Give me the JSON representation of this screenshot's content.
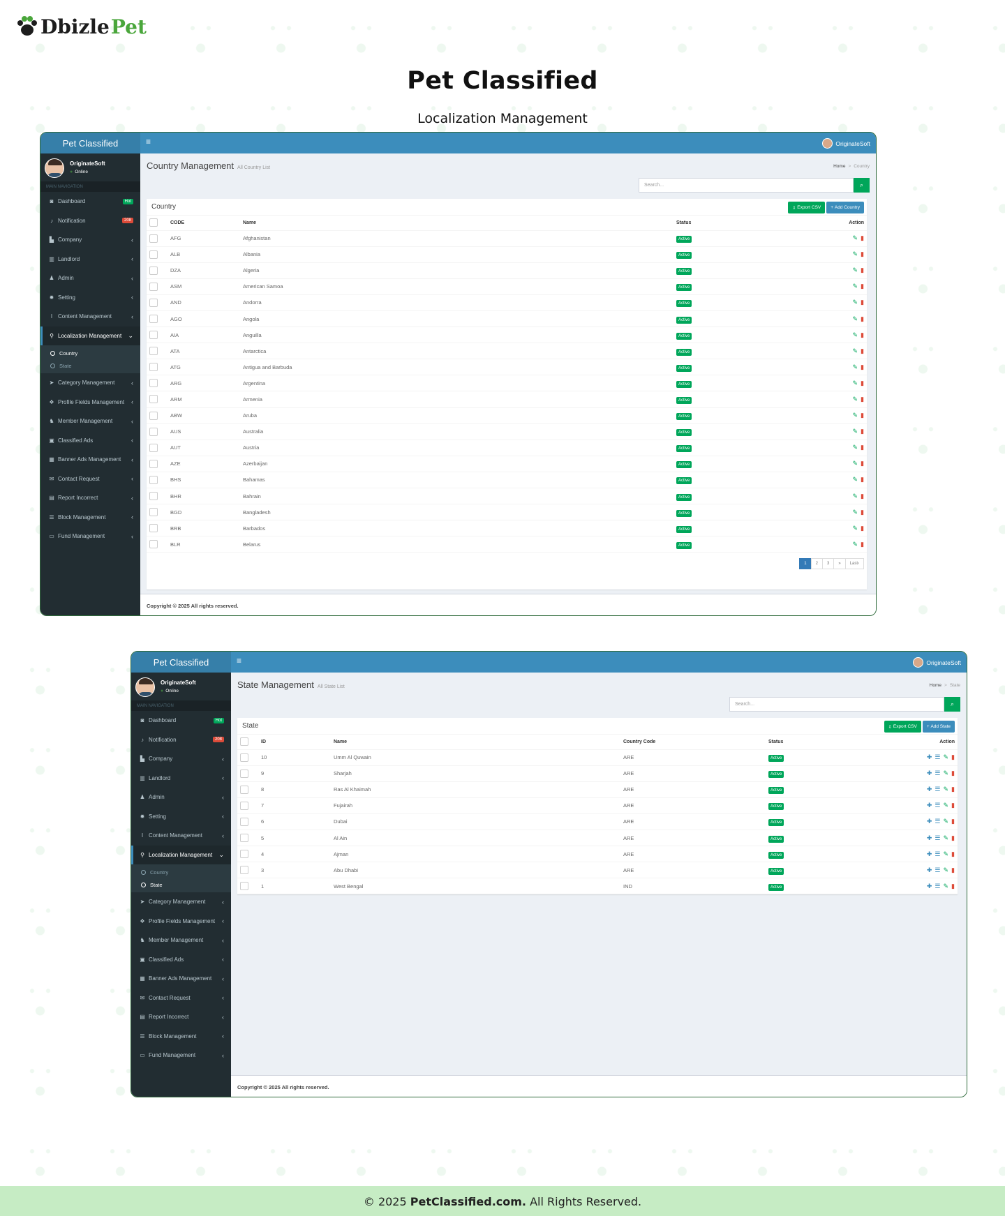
{
  "brand": {
    "part1": "Dbizle",
    "part2": "Pet"
  },
  "heading": "Pet Classified",
  "subheading": "Localization Management",
  "admin": {
    "logo": "Pet Classified",
    "toggle": "≡",
    "user": "OriginateSoft",
    "status": "Online",
    "nav_header": "MAIN NAVIGATION",
    "menu": [
      {
        "label": "Dashboard",
        "icon": "dashboard-icon",
        "glyph": "◙",
        "badge": "Hot"
      },
      {
        "label": "Notification",
        "icon": "bell-icon",
        "glyph": "♪",
        "badge": "208"
      },
      {
        "label": "Company",
        "icon": "chart-icon",
        "glyph": "▙"
      },
      {
        "label": "Landlord",
        "icon": "bank-icon",
        "glyph": "▥"
      },
      {
        "label": "Admin",
        "icon": "user-icon",
        "glyph": "♟"
      },
      {
        "label": "Setting",
        "icon": "gear-icon",
        "glyph": "✹"
      },
      {
        "label": "Content Management",
        "icon": "text-cursor-icon",
        "glyph": "I"
      },
      {
        "label": "Localization Management",
        "icon": "map-marker-icon",
        "glyph": "⚲"
      },
      {
        "label": "Category Management",
        "icon": "pointer-icon",
        "glyph": "➤"
      },
      {
        "label": "Profile Fields Management",
        "icon": "cubes-icon",
        "glyph": "❖"
      },
      {
        "label": "Member Management",
        "icon": "users-icon",
        "glyph": "♞"
      },
      {
        "label": "Classified Ads",
        "icon": "briefcase-icon",
        "glyph": "▣"
      },
      {
        "label": "Banner Ads Management",
        "icon": "calendar-icon",
        "glyph": "▦"
      },
      {
        "label": "Contact Request",
        "icon": "envelope-icon",
        "glyph": "✉"
      },
      {
        "label": "Report Incorrect",
        "icon": "report-icon",
        "glyph": "▤"
      },
      {
        "label": "Block Management",
        "icon": "list-icon",
        "glyph": "☰"
      },
      {
        "label": "Fund Management",
        "icon": "money-icon",
        "glyph": "▭"
      }
    ],
    "submenu": [
      "Country",
      "State"
    ],
    "home": "Home",
    "search_placeholder": "Search...",
    "export": "Export CSV",
    "copyright": "Copyright © 2025 All rights reserved."
  },
  "country_page": {
    "title": "Country Management",
    "subtitle": "All Country List",
    "crumb": "Country",
    "box_title": "Country",
    "add": "Add Country",
    "columns": [
      "CODE",
      "Name",
      "Status",
      "Action"
    ],
    "rows": [
      [
        "AFG",
        "Afghanistan"
      ],
      [
        "ALB",
        "Albania"
      ],
      [
        "DZA",
        "Algeria"
      ],
      [
        "ASM",
        "American Samoa"
      ],
      [
        "AND",
        "Andorra"
      ],
      [
        "AGO",
        "Angola"
      ],
      [
        "AIA",
        "Anguilla"
      ],
      [
        "ATA",
        "Antarctica"
      ],
      [
        "ATG",
        "Antigua and Barbuda"
      ],
      [
        "ARG",
        "Argentina"
      ],
      [
        "ARM",
        "Armenia"
      ],
      [
        "ABW",
        "Aruba"
      ],
      [
        "AUS",
        "Australia"
      ],
      [
        "AUT",
        "Austria"
      ],
      [
        "AZE",
        "Azerbaijan"
      ],
      [
        "BHS",
        "Bahamas"
      ],
      [
        "BHR",
        "Bahrain"
      ],
      [
        "BGD",
        "Bangladesh"
      ],
      [
        "BRB",
        "Barbados"
      ],
      [
        "BLR",
        "Belarus"
      ]
    ],
    "status": "Active",
    "pages": [
      "1",
      "2",
      "3",
      "»",
      "Last›"
    ]
  },
  "state_page": {
    "title": "State Management",
    "subtitle": "All State List",
    "crumb": "State",
    "box_title": "State",
    "add": "Add State",
    "columns": [
      "ID",
      "Name",
      "Country Code",
      "Status",
      "Action"
    ],
    "rows": [
      [
        "10",
        "Umm Al Quwain",
        "ARE"
      ],
      [
        "9",
        "Sharjah",
        "ARE"
      ],
      [
        "8",
        "Ras Al Khaimah",
        "ARE"
      ],
      [
        "7",
        "Fujairah",
        "ARE"
      ],
      [
        "6",
        "Dubai",
        "ARE"
      ],
      [
        "5",
        "Al Ain",
        "ARE"
      ],
      [
        "4",
        "Ajman",
        "ARE"
      ],
      [
        "3",
        "Abu Dhabi",
        "ARE"
      ],
      [
        "1",
        "West Bengal",
        "IND"
      ]
    ],
    "status": "Active"
  },
  "footer": {
    "prefix": "© 2025 ",
    "site": "PetClassified.com.",
    "suffix": " All Rights Reserved."
  },
  "colors": {
    "header": "#3c8dbc",
    "sidebar": "#222d32",
    "success": "#00a65a",
    "danger": "#dd4b39",
    "footer_bg": "#c6ecc4"
  }
}
